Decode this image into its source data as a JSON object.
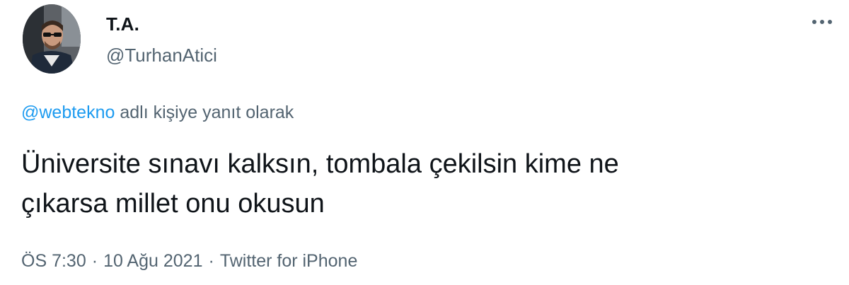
{
  "author": {
    "display_name": "T.A.",
    "handle": "@TurhanAtici",
    "avatar_icon": "profile-photo"
  },
  "more_icon": "ellipsis-icon",
  "reply_context": {
    "mention": "@webtekno",
    "text": " adlı kişiye yanıt olarak"
  },
  "tweet": {
    "text": "Üniversite sınavı kalksın, tombala çekilsin kime ne\nçıkarsa millet onu okusun"
  },
  "meta": {
    "time": "ÖS 7:30",
    "separator": "·",
    "date": "10 Ağu 2021",
    "source": "Twitter for iPhone"
  },
  "colors": {
    "link": "#1d9bf0",
    "secondary_text": "#536471",
    "primary_text": "#0f1419"
  }
}
